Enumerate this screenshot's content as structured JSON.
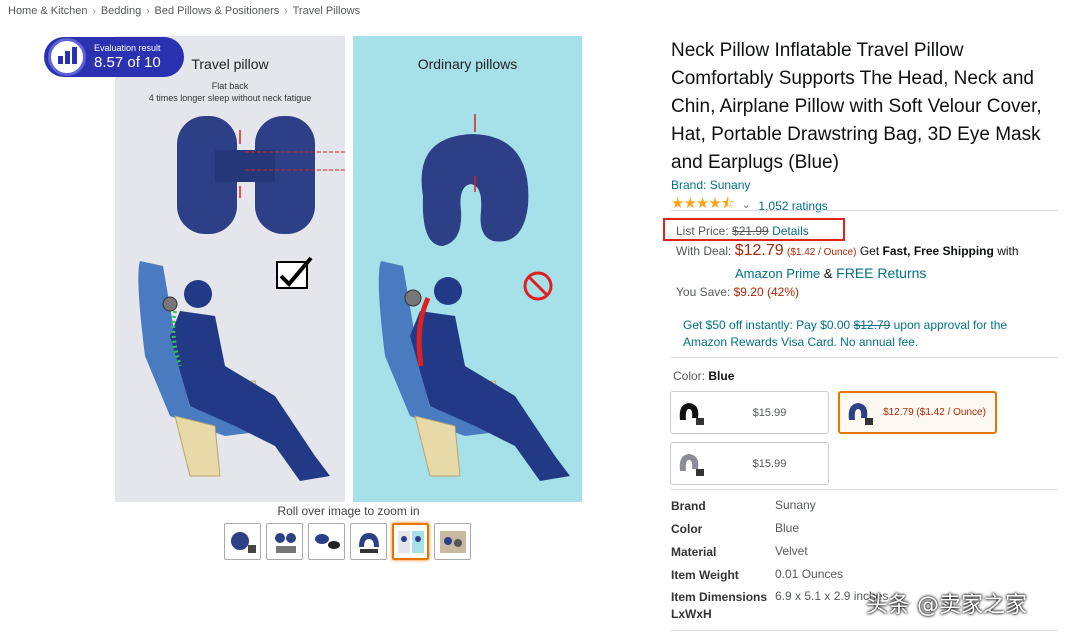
{
  "breadcrumb": [
    "Home & Kitchen",
    "Bedding",
    "Bed Pillows & Positioners",
    "Travel Pillows"
  ],
  "evaluation": {
    "label": "Evaluation result",
    "score": "8.57 of 10"
  },
  "image": {
    "left_title": "Travel pillow",
    "left_sub1": "Flat back",
    "left_sub2": "4 times longer sleep without neck fatigue",
    "right_title": "Ordinary pillows"
  },
  "zoom_hint": "Roll over image to zoom in",
  "thumbnail_count": 6,
  "active_thumbnail": 5,
  "product": {
    "title": "Neck Pillow Inflatable Travel Pillow Comfortably Supports The Head, Neck and Chin, Airplane Pillow with Soft Velour Cover, Hat, Portable Drawstring Bag, 3D Eye Mask and Earplugs (Blue)",
    "brand": "Brand: Sunany",
    "rating_value": 4.5,
    "ratings": "1,052 ratings"
  },
  "pricing": {
    "list_label": "List Price:",
    "list_price": "$21.99",
    "details_link": "Details",
    "deal_label": "With Deal:",
    "deal_price": "$12.79",
    "deal_unit": "($1.42 / Ounce)",
    "shipping_get": "Get",
    "shipping_fast": "Fast, Free Shipping",
    "shipping_with": "with",
    "prime": "Amazon Prime",
    "amp": "&",
    "free_returns": "FREE Returns",
    "save_label": "You Save:",
    "save_value": "$9.20 (42%)"
  },
  "promo": {
    "text1": "Get $50 off instantly: Pay $0.00",
    "strike": "$12.79",
    "text2": "upon approval for the Amazon Rewards Visa Card. No annual fee."
  },
  "color": {
    "label": "Color:",
    "value": "Blue"
  },
  "swatches": [
    {
      "price": "$15.99"
    },
    {
      "price": "$12.79 ($1.42 / Ounce)"
    },
    {
      "price": "$15.99"
    }
  ],
  "specs": [
    {
      "key": "Brand",
      "value": "Sunany"
    },
    {
      "key": "Color",
      "value": "Blue"
    },
    {
      "key": "Material",
      "value": "Velvet"
    },
    {
      "key": "Item Weight",
      "value": "0.01 Ounces"
    },
    {
      "key": "Item Dimensions LxWxH",
      "value": "6.9 x 5.1 x 2.9 inches"
    }
  ],
  "watermark": "头条 @卖家之家",
  "colors": {
    "accent": "#e77600",
    "link": "#007185",
    "price": "#b12704",
    "highlight": "#e0231c",
    "badge": "#2b32b2"
  }
}
